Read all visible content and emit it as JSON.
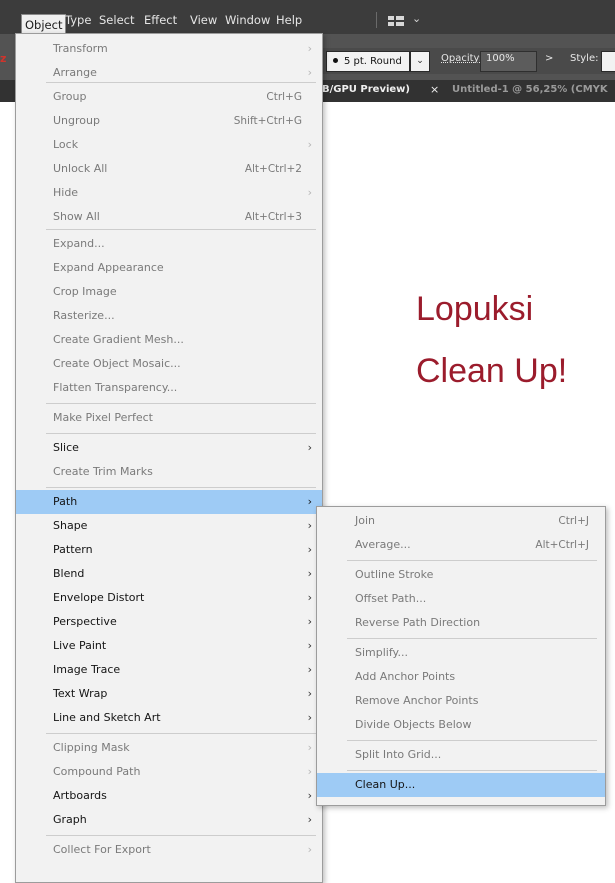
{
  "menubar": {
    "items": [
      "Object",
      "Type",
      "Select",
      "Effect",
      "View",
      "Window",
      "Help"
    ],
    "workspace_chevron": "⌄"
  },
  "controlbar": {
    "stroke_profile": "5 pt. Round",
    "opacity_label": "Opacity:",
    "opacity_value": "100%",
    "style_label": "Style:",
    "style_arrow": ">",
    "dropdown_arrow": "⌄"
  },
  "tabs": {
    "active_tab": "B/GPU Preview)",
    "close": "×",
    "inactive_tab": "Untitled-1 @ 56,25% (CMYK"
  },
  "left_accent": "z",
  "annotation": {
    "line1": "Lopuksi",
    "line2": "Clean Up!"
  },
  "object_menu": {
    "items": [
      {
        "label": "Transform",
        "shortcut": "",
        "submenu": true,
        "enabled": false
      },
      {
        "label": "Arrange",
        "shortcut": "",
        "submenu": true,
        "enabled": false
      },
      {
        "label": "Group",
        "shortcut": "Ctrl+G",
        "submenu": false,
        "enabled": false
      },
      {
        "label": "Ungroup",
        "shortcut": "Shift+Ctrl+G",
        "submenu": false,
        "enabled": false
      },
      {
        "label": "Lock",
        "shortcut": "",
        "submenu": true,
        "enabled": false
      },
      {
        "label": "Unlock All",
        "shortcut": "Alt+Ctrl+2",
        "submenu": false,
        "enabled": false
      },
      {
        "label": "Hide",
        "shortcut": "",
        "submenu": true,
        "enabled": false
      },
      {
        "label": "Show All",
        "shortcut": "Alt+Ctrl+3",
        "submenu": false,
        "enabled": false
      },
      {
        "label": "Expand...",
        "shortcut": "",
        "submenu": false,
        "enabled": false
      },
      {
        "label": "Expand Appearance",
        "shortcut": "",
        "submenu": false,
        "enabled": false
      },
      {
        "label": "Crop Image",
        "shortcut": "",
        "submenu": false,
        "enabled": false
      },
      {
        "label": "Rasterize...",
        "shortcut": "",
        "submenu": false,
        "enabled": false
      },
      {
        "label": "Create Gradient Mesh...",
        "shortcut": "",
        "submenu": false,
        "enabled": false
      },
      {
        "label": "Create Object Mosaic...",
        "shortcut": "",
        "submenu": false,
        "enabled": false
      },
      {
        "label": "Flatten Transparency...",
        "shortcut": "",
        "submenu": false,
        "enabled": false
      },
      {
        "label": "Make Pixel Perfect",
        "shortcut": "",
        "submenu": false,
        "enabled": false
      },
      {
        "label": "Slice",
        "shortcut": "",
        "submenu": true,
        "enabled": true
      },
      {
        "label": "Create Trim Marks",
        "shortcut": "",
        "submenu": false,
        "enabled": false
      },
      {
        "label": "Path",
        "shortcut": "",
        "submenu": true,
        "enabled": true,
        "highlighted": true
      },
      {
        "label": "Shape",
        "shortcut": "",
        "submenu": true,
        "enabled": true
      },
      {
        "label": "Pattern",
        "shortcut": "",
        "submenu": true,
        "enabled": true
      },
      {
        "label": "Blend",
        "shortcut": "",
        "submenu": true,
        "enabled": true
      },
      {
        "label": "Envelope Distort",
        "shortcut": "",
        "submenu": true,
        "enabled": true
      },
      {
        "label": "Perspective",
        "shortcut": "",
        "submenu": true,
        "enabled": true
      },
      {
        "label": "Live Paint",
        "shortcut": "",
        "submenu": true,
        "enabled": true
      },
      {
        "label": "Image Trace",
        "shortcut": "",
        "submenu": true,
        "enabled": true
      },
      {
        "label": "Text Wrap",
        "shortcut": "",
        "submenu": true,
        "enabled": true
      },
      {
        "label": "Line and Sketch Art",
        "shortcut": "",
        "submenu": true,
        "enabled": true
      },
      {
        "label": "Clipping Mask",
        "shortcut": "",
        "submenu": true,
        "enabled": false
      },
      {
        "label": "Compound Path",
        "shortcut": "",
        "submenu": true,
        "enabled": false
      },
      {
        "label": "Artboards",
        "shortcut": "",
        "submenu": true,
        "enabled": true
      },
      {
        "label": "Graph",
        "shortcut": "",
        "submenu": true,
        "enabled": true
      },
      {
        "label": "Collect For Export",
        "shortcut": "",
        "submenu": true,
        "enabled": false
      }
    ]
  },
  "path_submenu": {
    "items": [
      {
        "label": "Join",
        "shortcut": "Ctrl+J"
      },
      {
        "label": "Average...",
        "shortcut": "Alt+Ctrl+J"
      },
      {
        "label": "Outline Stroke",
        "shortcut": ""
      },
      {
        "label": "Offset Path...",
        "shortcut": ""
      },
      {
        "label": "Reverse Path Direction",
        "shortcut": ""
      },
      {
        "label": "Simplify...",
        "shortcut": ""
      },
      {
        "label": "Add Anchor Points",
        "shortcut": ""
      },
      {
        "label": "Remove Anchor Points",
        "shortcut": ""
      },
      {
        "label": "Divide Objects Below",
        "shortcut": ""
      },
      {
        "label": "Split Into Grid...",
        "shortcut": ""
      },
      {
        "label": "Clean Up...",
        "shortcut": "",
        "highlighted": true
      }
    ]
  }
}
